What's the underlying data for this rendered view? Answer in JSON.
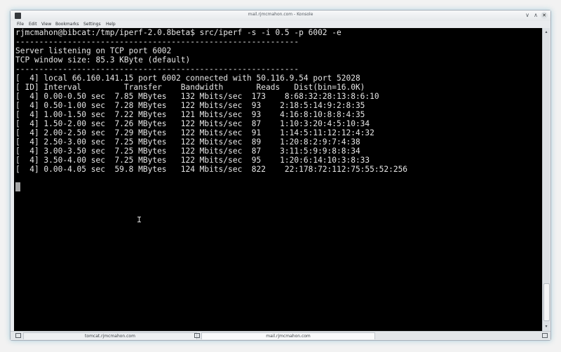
{
  "window": {
    "title": "mail.rjmcmahon.com - Konsole",
    "buttons": {
      "minimize": "∨",
      "maximize": "∧",
      "close": "✕"
    }
  },
  "menu": [
    "File",
    "Edit",
    "View",
    "Bookmarks",
    "Settings",
    "Help"
  ],
  "terminal": {
    "lines": [
      "rjmcmahon@bibcat:/tmp/iperf-2.0.8beta$ src/iperf -s -i 0.5 -p 6002 -e",
      "------------------------------------------------------------",
      "Server listening on TCP port 6002",
      "TCP window size: 85.3 KByte (default)",
      "------------------------------------------------------------",
      "[  4] local 66.160.141.15 port 6002 connected with 50.116.9.54 port 52028",
      "[ ID] Interval         Transfer    Bandwidth       Reads   Dist(bin=16.0K)",
      "[  4] 0.00-0.50 sec  7.85 MBytes   132 Mbits/sec  173    8:68:32:28:13:8:6:10",
      "[  4] 0.50-1.00 sec  7.28 MBytes   122 Mbits/sec  93    2:18:5:14:9:2:8:35",
      "[  4] 1.00-1.50 sec  7.22 MBytes   121 Mbits/sec  93    4:16:8:10:8:8:4:35",
      "[  4] 1.50-2.00 sec  7.26 MBytes   122 Mbits/sec  87    1:10:3:20:4:5:10:34",
      "[  4] 2.00-2.50 sec  7.29 MBytes   122 Mbits/sec  91    1:14:5:11:12:12:4:32",
      "[  4] 2.50-3.00 sec  7.25 MBytes   122 Mbits/sec  89    1:20:8:2:9:7:4:38",
      "[  4] 3.00-3.50 sec  7.25 MBytes   122 Mbits/sec  87    3:11:5:9:9:8:8:34",
      "[  4] 3.50-4.00 sec  7.25 MBytes   122 Mbits/sec  95    1:20:6:14:10:3:8:33",
      "[  4] 0.00-4.05 sec  59.8 MBytes   124 Mbits/sec  822    22:178:72:112:75:55:52:256"
    ]
  },
  "tabs": [
    {
      "label": "tomcat.rjmcmahon.com",
      "active": false
    },
    {
      "label": "mail.rjmcmahon.com",
      "active": true
    }
  ],
  "scrollbar": {
    "up": "▴",
    "down": "▾"
  }
}
